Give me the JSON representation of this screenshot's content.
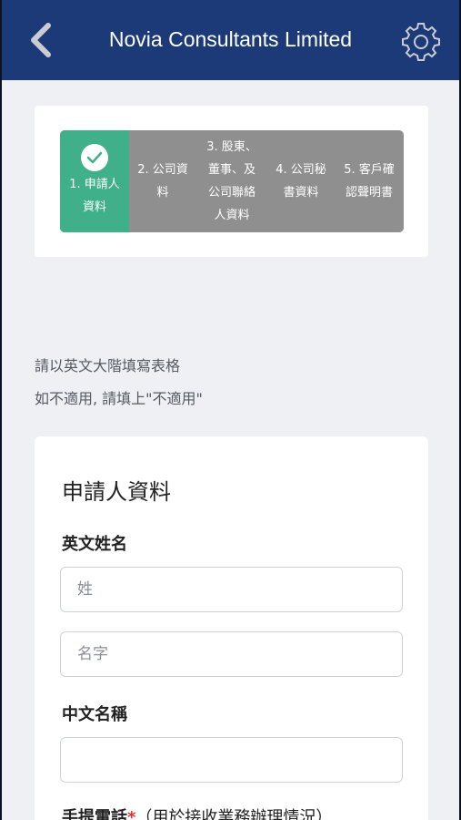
{
  "header": {
    "title": "Novia Consultants Limited",
    "back_icon": "chevron-left-icon",
    "settings_icon": "gear-icon"
  },
  "progress": {
    "steps": [
      {
        "label": "1. 申請人\n資料",
        "status": "completed"
      },
      {
        "label": "2. 公司資\n料",
        "status": "pending"
      },
      {
        "label": "3. 股東、\n董事、及\n公司聯絡\n人資料",
        "status": "pending"
      },
      {
        "label": "4. 公司秘\n書資料",
        "status": "pending"
      },
      {
        "label": "5. 客戶確\n認聲明書",
        "status": "pending"
      }
    ]
  },
  "instructions": {
    "line1": "請以英文大階填寫表格",
    "line2": "如不適用, 請填上\"不適用\""
  },
  "form": {
    "section_title": "申請人資料",
    "english_name_label": "英文姓名",
    "surname_placeholder": "姓",
    "given_name_placeholder": "名字",
    "chinese_name_label": "中文名稱",
    "chinese_name_value": "",
    "mobile_label": "手提電話",
    "mobile_required": "*",
    "mobile_note": "（用於接收業務辦理情況）"
  },
  "colors": {
    "header_bg": "#1d3a78",
    "step_done": "#3fb08a",
    "step_pending": "#8f8f8f",
    "required": "#e03030"
  }
}
